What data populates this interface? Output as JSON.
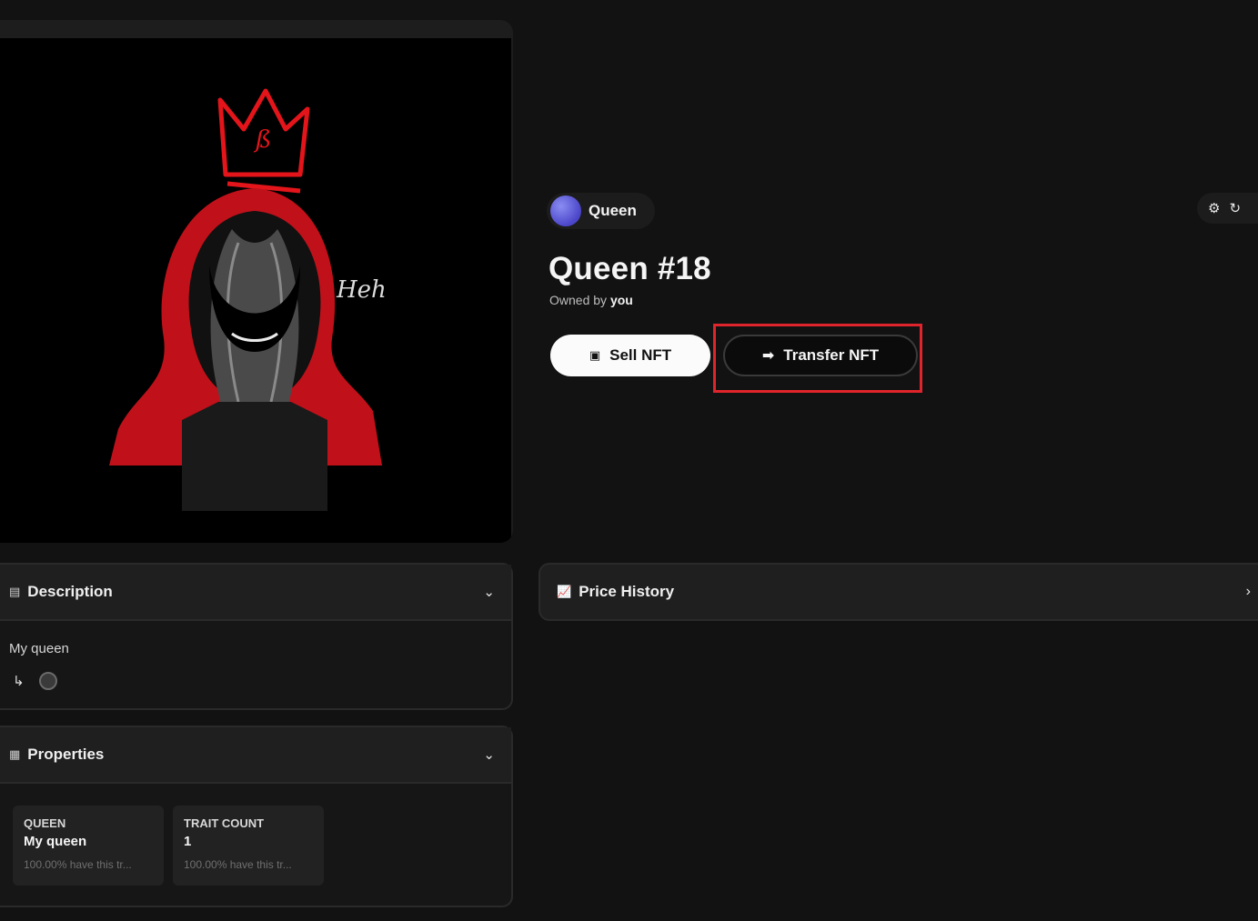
{
  "collection": {
    "name": "Queen"
  },
  "nft": {
    "title": "Queen #18",
    "owned_prefix": "Owned by",
    "owner": "you"
  },
  "actions": {
    "sell_label": "Sell NFT",
    "transfer_label": "Transfer NFT"
  },
  "description": {
    "heading": "Description",
    "text": "My queen"
  },
  "properties": {
    "heading": "Properties",
    "traits": [
      {
        "type": "QUEEN",
        "value": "My queen",
        "rarity": "100.00% have this tr..."
      },
      {
        "type": "TRAIT COUNT",
        "value": "1",
        "rarity": "100.00% have this tr..."
      }
    ]
  },
  "price_history": {
    "heading": "Price History"
  },
  "icons": {
    "description": "description-icon",
    "properties": "grid-icon",
    "price_history": "chart-icon",
    "sell": "tag-icon",
    "transfer": "arrow-right-icon",
    "refresh": "refresh-icon",
    "settings": "gear-icon"
  },
  "colors": {
    "highlight": "#e0242b",
    "accent_red": "#e3151b"
  }
}
